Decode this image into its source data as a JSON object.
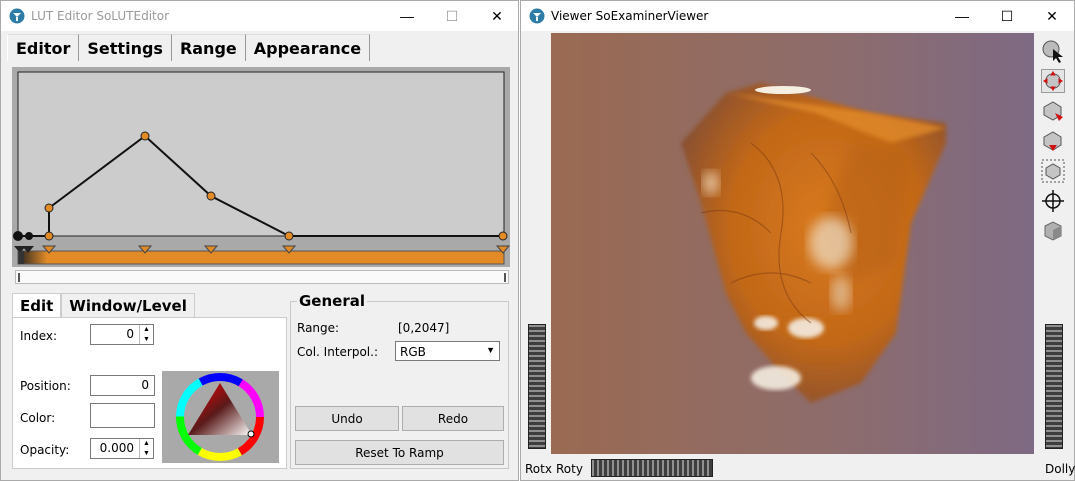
{
  "lut_window": {
    "title": "LUT Editor SoLUTEditor",
    "tabs": [
      "Editor",
      "Settings",
      "Range",
      "Appearance"
    ],
    "active_tab": "Editor",
    "curve_color": "#e28a26",
    "sub_tabs": [
      "Edit",
      "Window/Level"
    ],
    "edit": {
      "index_label": "Index:",
      "index_value": "0",
      "position_label": "Position:",
      "position_value": "0",
      "color_label": "Color:",
      "opacity_label": "Opacity:",
      "opacity_value": "0.000"
    },
    "general": {
      "title": "General",
      "range_label": "Range:",
      "range_value": "[0,2047]",
      "interp_label": "Col. Interpol.:",
      "interp_value": "RGB",
      "undo_label": "Undo",
      "redo_label": "Redo",
      "reset_label": "Reset To Ramp"
    }
  },
  "viewer_window": {
    "title": "Viewer SoExaminerViewer",
    "rotx_label": "Rotx",
    "roty_label": "Roty",
    "dolly_label": "Dolly",
    "toolbar_icons": [
      "pick-mode-icon",
      "view-mode-icon",
      "home-icon",
      "set-home-icon",
      "view-all-icon",
      "seek-icon",
      "projection-icon"
    ]
  }
}
